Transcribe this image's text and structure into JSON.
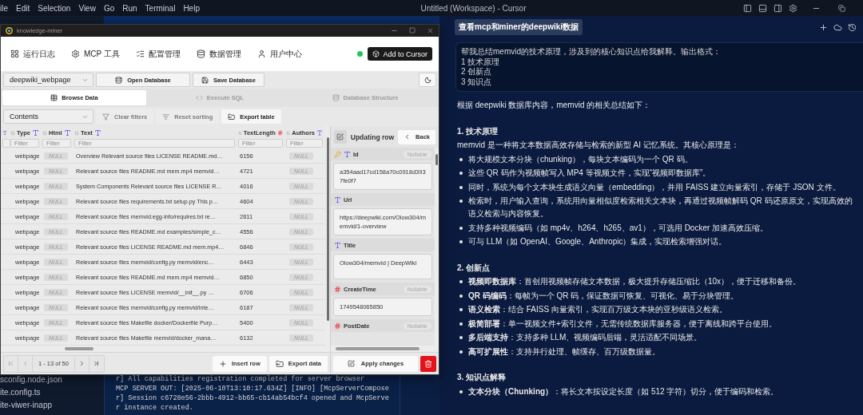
{
  "menu_bar": {
    "items": [
      "ile",
      "Edit",
      "Selection",
      "View",
      "Go",
      "Run",
      "Terminal",
      "Help"
    ],
    "title": "Untitled (Workspace) - Cursor"
  },
  "explorer": {
    "files": [
      "sconfig.node.json",
      "ite.config.ts",
      "ite-viwer-inapp"
    ]
  },
  "terminal": {
    "lines": [
      "r] All capabilities registration completed for server browser",
      "MCP SERVER OUT: [2025-06-10T13:10:17.634Z] [INFO] [McpServerCompose",
      "r] Session c6728e56-2bbb-4912-bb65-cb14ab54bcf4 opened and McpServe",
      "r instance created."
    ]
  },
  "app_window": {
    "title": "knowledge-miner",
    "nav": {
      "items": [
        "运行日志",
        "MCP 工具",
        "配置管理",
        "数据管理",
        "用户中心"
      ],
      "online": true,
      "add_button": "Add to Cursor"
    },
    "toolbar": {
      "table_select": "deepwiki_webpage",
      "buttons": [
        "Open Database",
        "Save Database"
      ]
    },
    "tabs": [
      {
        "label": "Browse Data",
        "selected": true
      },
      {
        "label": "Execute SQL",
        "selected": false
      },
      {
        "label": "Database Structure",
        "selected": false
      }
    ],
    "filter_bar": {
      "view_select": "Contents",
      "actions": [
        {
          "label": "Clear filters",
          "disabled": true
        },
        {
          "label": "Reset sorting",
          "disabled": true
        },
        {
          "label": "Export table",
          "disabled": false
        }
      ]
    },
    "table": {
      "columns": [
        {
          "kind": "text"
        },
        {
          "name": "Type",
          "kind": "text",
          "placeholder": "Filter"
        },
        {
          "name": "Html",
          "kind": "text",
          "placeholder": "Filter"
        },
        {
          "name": "Text",
          "kind": "text",
          "placeholder": "Filter"
        },
        {
          "name": "TextLength",
          "kind": "number",
          "placeholder": "Filter"
        },
        {
          "name": "Authors",
          "kind": "text",
          "placeholder": "Filter"
        }
      ],
      "rows": [
        {
          "type": "webpage",
          "html": "NULL",
          "text": "Overview Relevant source files LICENSE README.md…",
          "text_length": "6156",
          "authors": "NULL"
        },
        {
          "type": "webpage",
          "html": "NULL",
          "text": "Relevant source files README.md mem.mp4 memvid…",
          "text_length": "4721",
          "authors": "NULL"
        },
        {
          "type": "webpage",
          "html": "NULL",
          "text": "System Components Relevant source files LICENSE R…",
          "text_length": "4016",
          "authors": "NULL"
        },
        {
          "type": "webpage",
          "html": "NULL",
          "text": "Relevant source files requirements.txt setup.py This p…",
          "text_length": "4604",
          "authors": "NULL"
        },
        {
          "type": "webpage",
          "html": "NULL",
          "text": "Relevant source files memvid.egg-info/requires.txt re…",
          "text_length": "2611",
          "authors": "NULL"
        },
        {
          "type": "webpage",
          "html": "NULL",
          "text": "Relevant source files README.md examples/simple_c…",
          "text_length": "4556",
          "authors": "NULL"
        },
        {
          "type": "webpage",
          "html": "NULL",
          "text": "Relevant source files LICENSE README.md mem.mp4…",
          "text_length": "6846",
          "authors": "NULL"
        },
        {
          "type": "webpage",
          "html": "NULL",
          "text": "Relevant source files memvid/config.py memvid/enc…",
          "text_length": "6443",
          "authors": "NULL"
        },
        {
          "type": "webpage",
          "html": "NULL",
          "text": "Relevant source files README.md mem.mp4 memvid…",
          "text_length": "6850",
          "authors": "NULL"
        },
        {
          "type": "webpage",
          "html": "NULL",
          "text": "Relevant source files LICENSE memvid/__init__.py …",
          "text_length": "6706",
          "authors": "NULL"
        },
        {
          "type": "webpage",
          "html": "NULL",
          "text": "Relevant source files memvid/config.py memvid/inte…",
          "text_length": "6187",
          "authors": "NULL"
        },
        {
          "type": "webpage",
          "html": "NULL",
          "text": "Relevant source files Makefile docker/Dockerfile Purp…",
          "text_length": "5400",
          "authors": "NULL"
        },
        {
          "type": "webpage",
          "html": "NULL",
          "text": "Relevant source files Makefile memvid/docker_mana…",
          "text_length": "6132",
          "authors": "NULL"
        }
      ]
    },
    "pagination": {
      "range": "1 - 13 of 50"
    },
    "table_buttons": [
      "Insert row",
      "Export data"
    ],
    "editor": {
      "title": "Updating row",
      "back": "Back",
      "apply": "Apply changes",
      "fields": [
        {
          "name": "Id",
          "kind": "text",
          "primary_key": true,
          "badge": "Nullable",
          "value": "a354aad17cd158a70c0918d3937fe0f7"
        },
        {
          "name": "Url",
          "kind": "text",
          "primary_key": false,
          "value": "https://deepwiki.com/Olow304/memvid/1-overview"
        },
        {
          "name": "Title",
          "kind": "text",
          "primary_key": false,
          "value": "Olow304/memvid | DeepWiki"
        },
        {
          "name": "CreateTime",
          "kind": "number",
          "primary_key": false,
          "badge": "Nullable",
          "value": "1749548065850"
        },
        {
          "name": "PostDate",
          "kind": "number",
          "primary_key": false,
          "badge": "Nullable"
        }
      ]
    }
  },
  "chat": {
    "chip": "查看mcp和miner的deepwiki数据",
    "request": [
      "帮我总结memvid的技术原理，涉及到的核心知识点给我解释。输出格式：",
      "1 技术原理",
      "2 创新点",
      "3 知识点"
    ],
    "answer": [
      {
        "kind": "paragraph",
        "text": "根据 deepwiki 数据库内容，memvid 的相关总结如下："
      },
      {
        "kind": "heading",
        "text": "1. 技术原理"
      },
      {
        "kind": "paragraph",
        "text": "memvid 是一种将文本数据高效存储与检索的新型 AI 记忆系统。其核心原理是："
      },
      {
        "kind": "bullet",
        "text": "将大规模文本分块（chunking），每块文本编码为一个 QR 码。"
      },
      {
        "kind": "bullet",
        "text": "这些 QR 码作为视频帧写入 MP4 等视频文件，实现“视频即数据库”。"
      },
      {
        "kind": "bullet",
        "text": "同时，系统为每个文本块生成语义向量（embedding），并用 FAISS 建立向量索引，存储于 JSON 文件。"
      },
      {
        "kind": "bullet",
        "text": "检索时，用户输入查询，系统用向量相似度检索相关文本块，再通过视频帧解码 QR 码还原原文，实现高效的语义检索与内容恢复。"
      },
      {
        "kind": "bullet",
        "text": "支持多种视频编码（如 mp4v、h264、h265、av1），可选用 Docker 加速高效压缩。"
      },
      {
        "kind": "bullet",
        "text": "可与 LLM（如 OpenAI、Google、Anthropic）集成，实现检索增强对话。"
      },
      {
        "kind": "heading",
        "text": "2. 创新点"
      },
      {
        "kind": "bullet",
        "text": "**视频即数据库**：首创用视频帧存储文本数据，极大提升存储压缩比（10x），便于迁移和备份。"
      },
      {
        "kind": "bullet",
        "text": "**QR 码编码**：每帧为一个 QR 码，保证数据可恢复、可视化、易于分块管理。"
      },
      {
        "kind": "bullet",
        "text": "**语义检索**：结合 FAISS 向量索引，实现百万级文本块的亚秒级语义检索。"
      },
      {
        "kind": "bullet",
        "text": "**极简部署**：单一视频文件+索引文件，无需传统数据库服务器，便于离线和跨平台使用。"
      },
      {
        "kind": "bullet",
        "text": "**多后端支持**：支持多种 LLM、视频编码后端，灵活适配不同场景。"
      },
      {
        "kind": "bullet",
        "text": "**高可扩展性**：支持并行处理、帧缓存、百万级数据量。"
      },
      {
        "kind": "heading",
        "text": "3. 知识点解释"
      },
      {
        "kind": "bullet",
        "text": "**文本分块（Chunking）**：将长文本按设定长度（如 512 字符）切分，便于编码和检索。"
      }
    ]
  }
}
